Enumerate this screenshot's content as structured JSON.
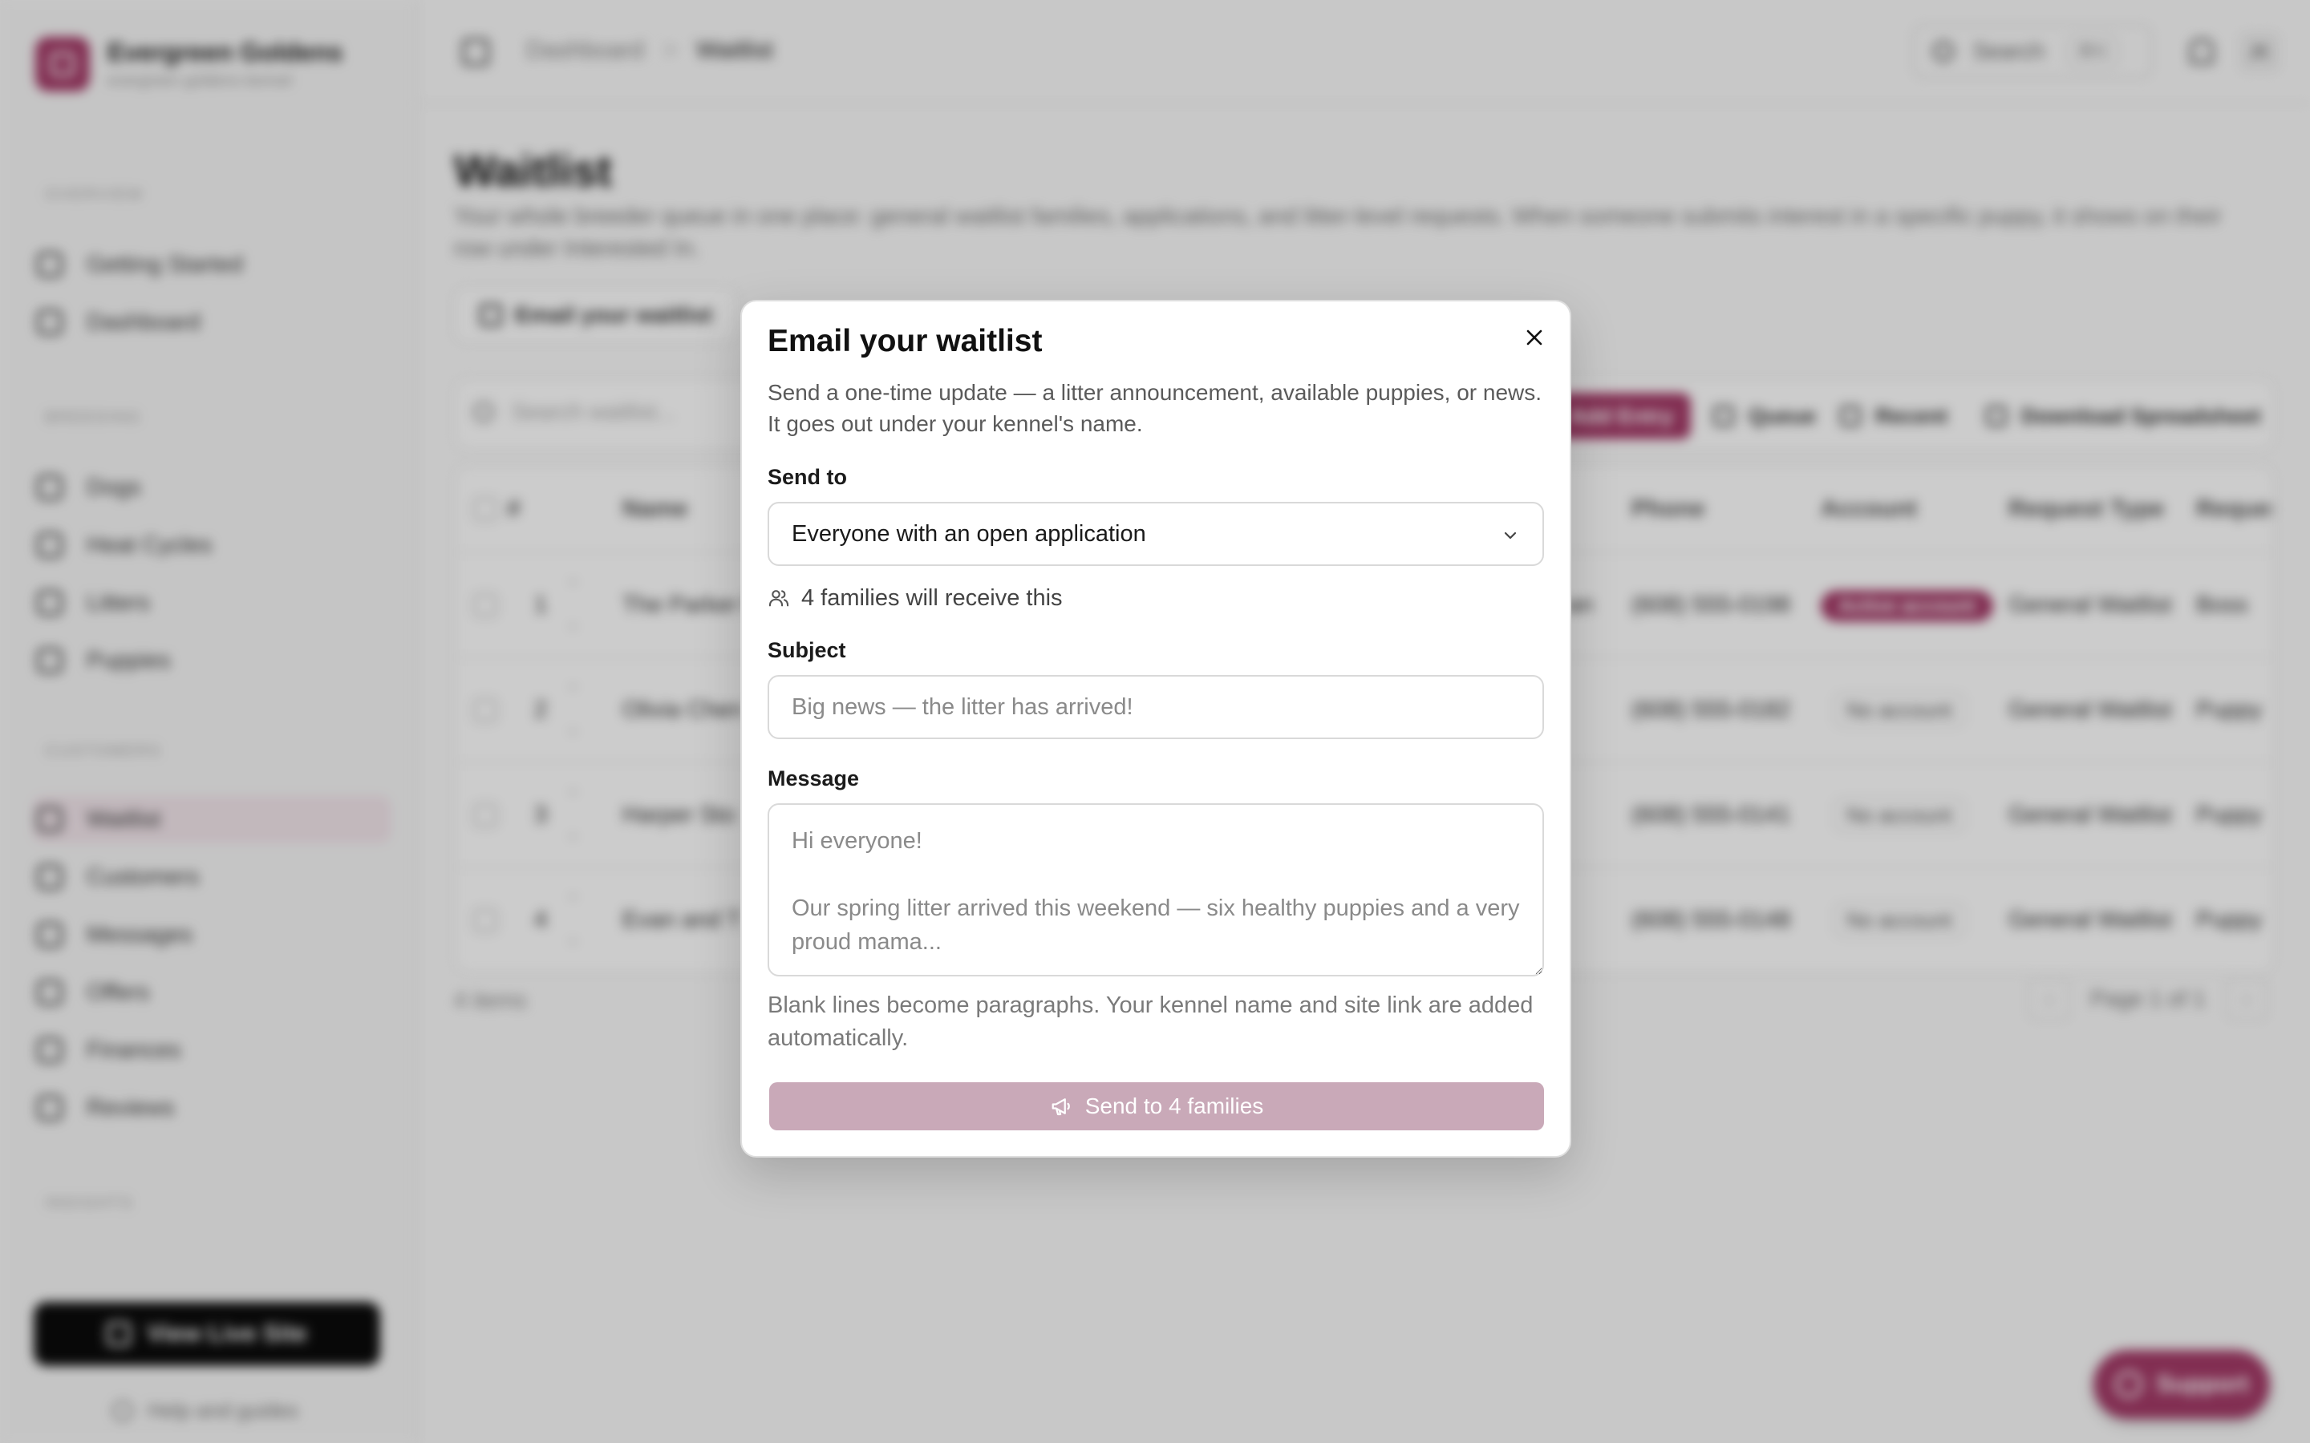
{
  "brand": {
    "name": "Evergreen Goldens",
    "subtitle": "evergreen goldens kennel"
  },
  "sidebar": {
    "sections": [
      {
        "label": "OVERVIEW",
        "items": [
          {
            "label": "Getting Started",
            "icon": "rocket-icon"
          },
          {
            "label": "Dashboard",
            "icon": "dashboard-icon"
          }
        ]
      },
      {
        "label": "BREEDING",
        "items": [
          {
            "label": "Dogs",
            "icon": "dog-icon"
          },
          {
            "label": "Heat Cycles",
            "icon": "cycle-icon"
          },
          {
            "label": "Litters",
            "icon": "litter-icon"
          },
          {
            "label": "Puppies",
            "icon": "paw-icon"
          }
        ]
      },
      {
        "label": "CUSTOMERS",
        "items": [
          {
            "label": "Waitlist",
            "icon": "list-icon",
            "active": true
          },
          {
            "label": "Customers",
            "icon": "users-icon"
          },
          {
            "label": "Messages",
            "icon": "message-icon"
          },
          {
            "label": "Offers",
            "icon": "tag-icon"
          },
          {
            "label": "Finances",
            "icon": "wallet-icon"
          },
          {
            "label": "Reviews",
            "icon": "star-icon"
          }
        ]
      },
      {
        "label": "INSIGHTS",
        "items": []
      }
    ],
    "live_site_label": "View Live Site",
    "help_label": "Help and guides"
  },
  "topbar": {
    "breadcrumb": [
      "Dashboard",
      "Waitlist"
    ],
    "search_label": "Search",
    "search_shortcut": "⌘K",
    "avatar_initials": "JK"
  },
  "page": {
    "title": "Waitlist",
    "description": "Your whole breeder queue in one place: general waitlist families, applications, and litter-level requests. When someone submits interest in a specific puppy, it shows on their row under Interested In.",
    "email_button_label": "Email your waitlist",
    "toolbar": {
      "search_placeholder": "Search waitlist...",
      "add_label": "Add Entry",
      "queue_label": "Queue",
      "recent_label": "Recent",
      "download_label": "Download Spreadsheet"
    },
    "table": {
      "columns": [
        "#",
        "Name",
        "Phone",
        "Account",
        "Request Type",
        "Reques"
      ],
      "rows": [
        {
          "num": "1",
          "name": "The Parker F",
          "suffix": "an",
          "phone": "(608) 555-0198",
          "account": "Active account",
          "account_active": true,
          "request_type": "General Waitlist",
          "request": "Boss"
        },
        {
          "num": "2",
          "name": "Olivia Chen",
          "suffix": "",
          "phone": "(608) 555-0182",
          "account": "No account",
          "account_active": false,
          "request_type": "General Waitlist",
          "request": "Puppy"
        },
        {
          "num": "3",
          "name": "Harper Sto",
          "suffix": "",
          "phone": "(608) 555-0141",
          "account": "No account",
          "account_active": false,
          "request_type": "General Waitlist",
          "request": "Puppy"
        },
        {
          "num": "4",
          "name": "Evan and T",
          "suffix": "",
          "phone": "(608) 555-0148",
          "account": "No account",
          "account_active": false,
          "request_type": "General Waitlist",
          "request": "Puppy"
        }
      ]
    },
    "items_count": "4 items",
    "pagination": "Page 1 of 1",
    "support_label": "Support"
  },
  "modal": {
    "title": "Email your waitlist",
    "description": "Send a one-time update — a litter announcement, available puppies, or news. It goes out under your kennel's name.",
    "send_to_label": "Send to",
    "send_to_value": "Everyone with an open application",
    "recipients_text": "4 families will receive this",
    "subject_label": "Subject",
    "subject_placeholder": "Big news — the litter has arrived!",
    "message_label": "Message",
    "message_placeholder": "Hi everyone!\n\nOur spring litter arrived this weekend — six healthy puppies and a very proud mama...",
    "hint": "Blank lines become paragraphs. Your kennel name and site link are added automatically.",
    "send_button_label": "Send to 4 families"
  },
  "colors": {
    "accent": "#a33a67",
    "send_disabled": "#c9a9b8",
    "overlay": "rgba(0,0,0,0.2)"
  }
}
